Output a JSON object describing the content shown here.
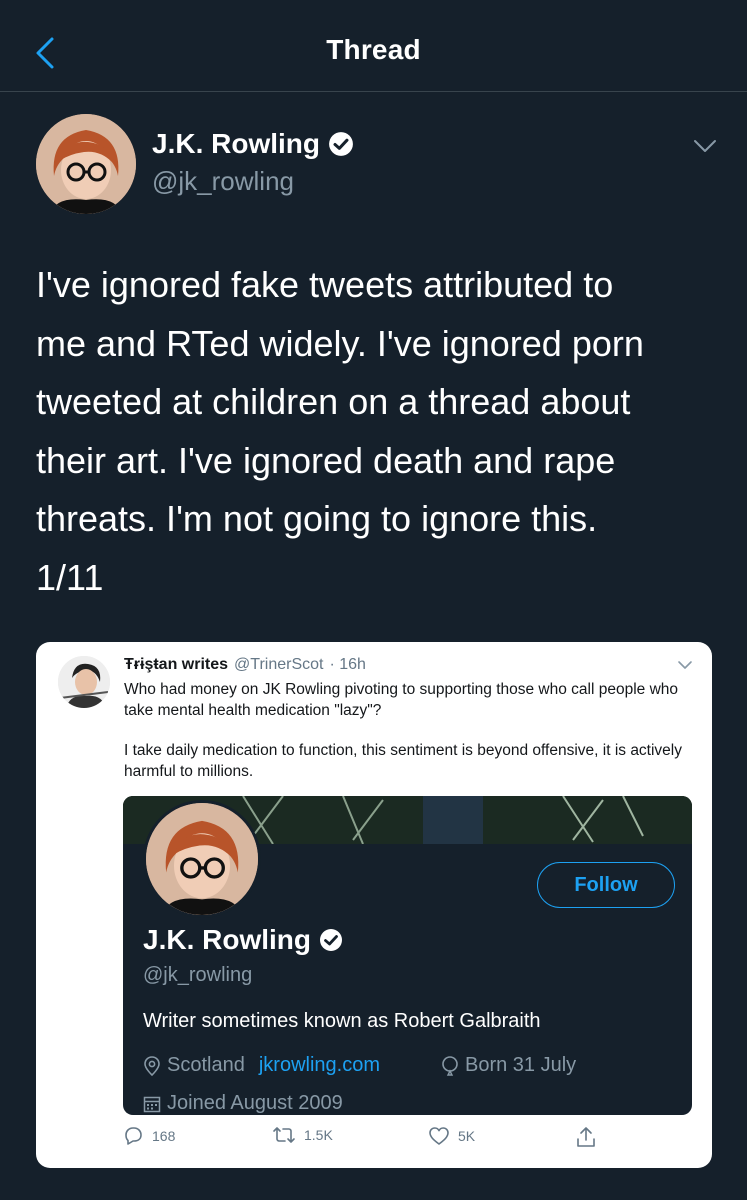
{
  "header": {
    "title": "Thread"
  },
  "tweet": {
    "author": {
      "name": "J.K. Rowling",
      "handle": "@jk_rowling",
      "verified": true
    },
    "text": "I've ignored fake tweets attributed to\nme and RTed widely. I've ignored porn\ntweeted at children on a thread about\ntheir art. I've ignored death and rape\nthreats. I'm not going to ignore this.\n1/11"
  },
  "embedded_tweet": {
    "author": {
      "name": "Ŧɍɨşŧan writes",
      "handle": "@TrinerScot",
      "time": "· 16h"
    },
    "paragraphs": [
      "Who had money on JK Rowling pivoting to supporting those who call people who take mental health medication \"lazy\"?",
      "I take daily medication to function, this sentiment is beyond offensive, it is actively harmful to millions."
    ],
    "profile_card": {
      "name": "J.K. Rowling",
      "handle": "@jk_rowling",
      "follow_label": "Follow",
      "bio": "Writer sometimes known as Robert Galbraith",
      "location": "Scotland",
      "website": "jkrowling.com",
      "birthday": "Born 31 July",
      "joined": "Joined August 2009"
    },
    "actions": {
      "replies": "168",
      "retweets": "1.5K",
      "likes": "5K"
    }
  },
  "colors": {
    "background": "#15202b",
    "accent": "#1da1f2",
    "secondary_text": "#8899a6",
    "divider": "#38444d"
  },
  "icons": [
    "back-chevron-icon",
    "verified-badge-icon",
    "chevron-down-icon",
    "location-icon",
    "birthday-icon",
    "calendar-icon",
    "reply-icon",
    "retweet-icon",
    "like-icon",
    "share-icon"
  ]
}
